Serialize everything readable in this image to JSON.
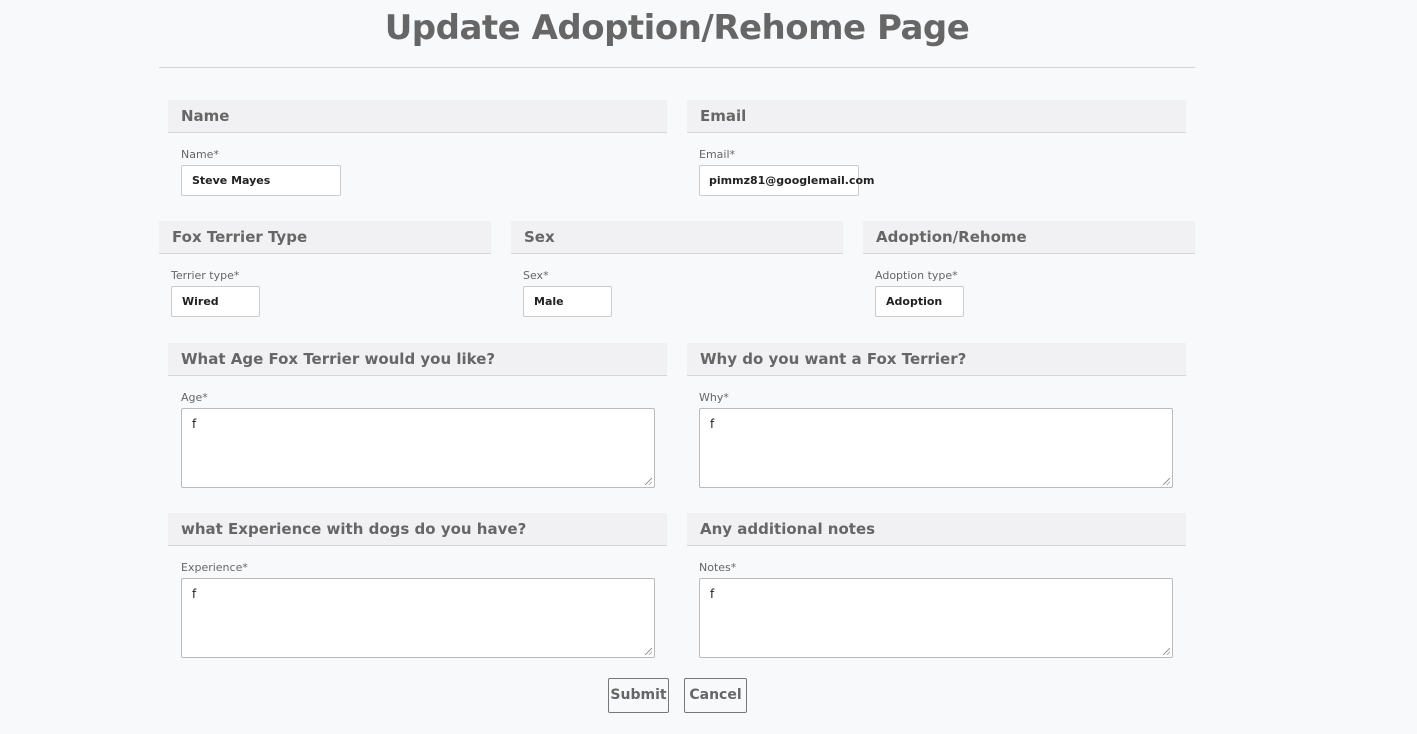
{
  "page": {
    "title": "Update Adoption/Rehome Page"
  },
  "sections": {
    "name": {
      "header": "Name",
      "label": "Name*",
      "value": "Steve Mayes"
    },
    "email": {
      "header": "Email",
      "label": "Email*",
      "value": "pimmz81@googlemail.com"
    },
    "terrier": {
      "header": "Fox Terrier Type",
      "label": "Terrier type*",
      "value": "Wired"
    },
    "sex": {
      "header": "Sex",
      "label": "Sex*",
      "value": "Male"
    },
    "adoption": {
      "header": "Adoption/Rehome",
      "label": "Adoption type*",
      "value": "Adoption"
    },
    "age": {
      "header": "What Age Fox Terrier would you like?",
      "label": "Age*",
      "value": "f"
    },
    "why": {
      "header": "Why do you want a Fox Terrier?",
      "label": "Why*",
      "value": "f"
    },
    "experience": {
      "header": "what Experience with dogs do you have?",
      "label": "Experience*",
      "value": "f"
    },
    "notes": {
      "header": "Any additional notes",
      "label": "Notes*",
      "value": "f"
    }
  },
  "actions": {
    "submit_label": "Submit",
    "cancel_label": "Cancel"
  }
}
